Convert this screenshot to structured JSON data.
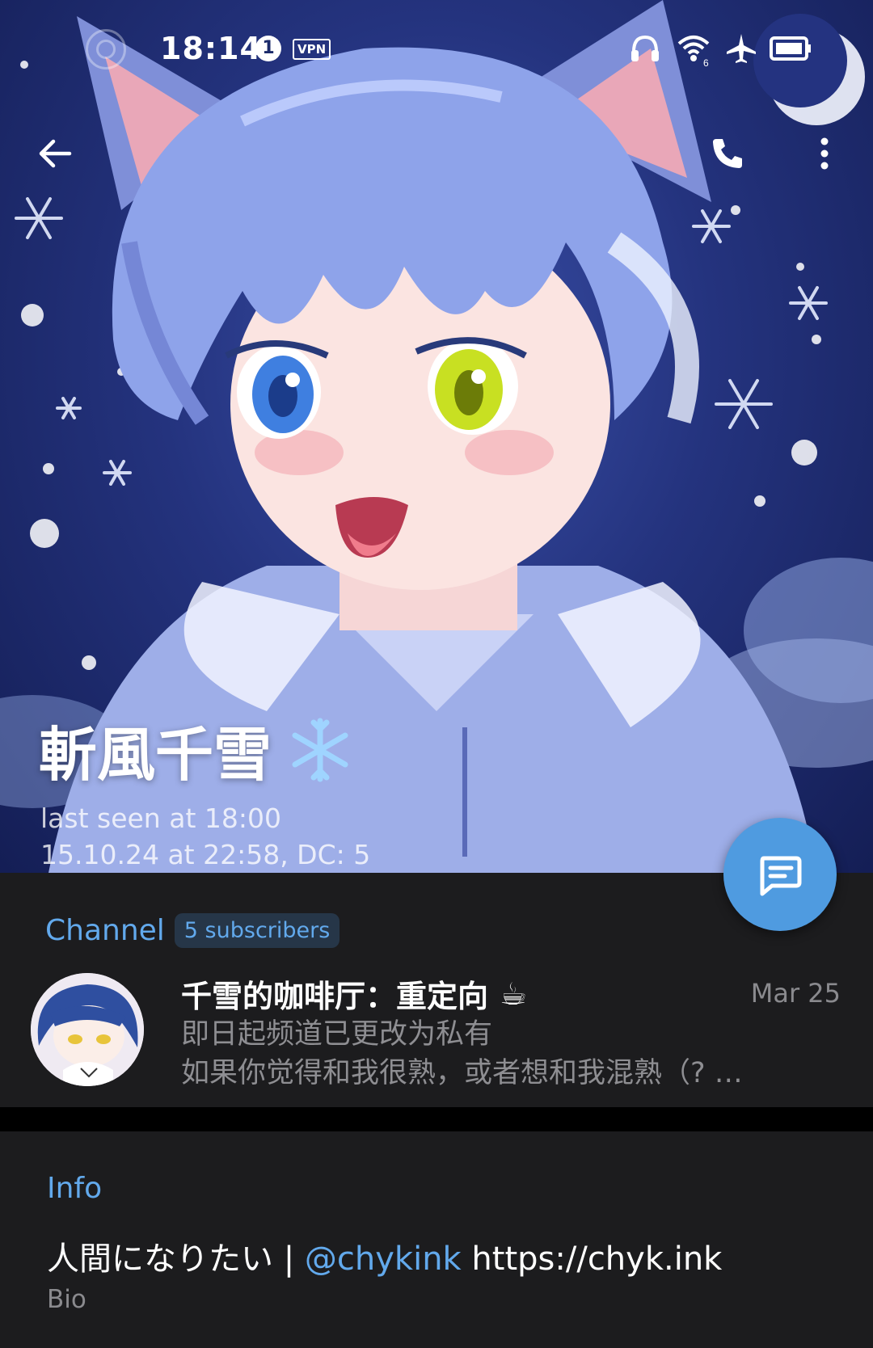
{
  "status_bar": {
    "time": "18:14",
    "notification_count": "1",
    "vpn": "VPN",
    "wifi_label": "6"
  },
  "profile": {
    "name": "斬風千雪",
    "name_emoji": "❄️",
    "last_seen": "last seen at 18:00",
    "meta": "15.10.24 at 22:58, DC: 5"
  },
  "channel": {
    "section_title": "Channel",
    "subscribers": "5 subscribers",
    "name": "千雪的咖啡厅：重定向",
    "name_emoji": "☕",
    "date": "Mar 25",
    "message_line1": "即日起频道已更改为私有",
    "message_line2": "如果你觉得和我很熟，或者想和我混熟（? …"
  },
  "info": {
    "section_title": "Info",
    "bio_prefix": "人間になりたい | ",
    "bio_mention": "@chykink",
    "bio_link": " https://chyk.ink",
    "bio_label": "Bio"
  },
  "colors": {
    "accent": "#62a9ec",
    "fab": "#4f9be0",
    "card_bg": "#1c1c1e",
    "hero_bg": "#24337e"
  },
  "icons": {
    "back": "arrow-left-icon",
    "call": "phone-icon",
    "more": "more-vertical-icon",
    "fab": "message-icon"
  }
}
